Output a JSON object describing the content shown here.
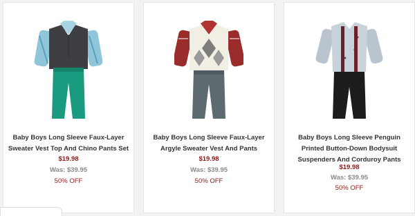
{
  "products": [
    {
      "title": "Baby Boys Long Sleeve Faux-Layer Sweater Vest Top And Chino Pants Set",
      "price": "$19.98",
      "was": "Was: $39.95",
      "discount": "50% OFF",
      "image_icon": "outfit-vest-chino-image"
    },
    {
      "title": "Baby Boys Long Sleeve Faux-Layer Argyle Sweater Vest And Pants",
      "price": "$19.98",
      "was": "Was: $39.95",
      "discount": "50% OFF",
      "image_icon": "outfit-argyle-vest-image"
    },
    {
      "title": "Baby Boys Long Sleeve Penguin Printed Button-Down Bodysuit Suspenders And Corduroy Pants",
      "price": "$19.98",
      "was": "Was: $39.95",
      "discount": "50% OFF",
      "image_icon": "outfit-suspenders-image"
    }
  ],
  "colors": {
    "price": "#8b1a1a",
    "was": "#8a8a8a",
    "title": "#333333"
  }
}
